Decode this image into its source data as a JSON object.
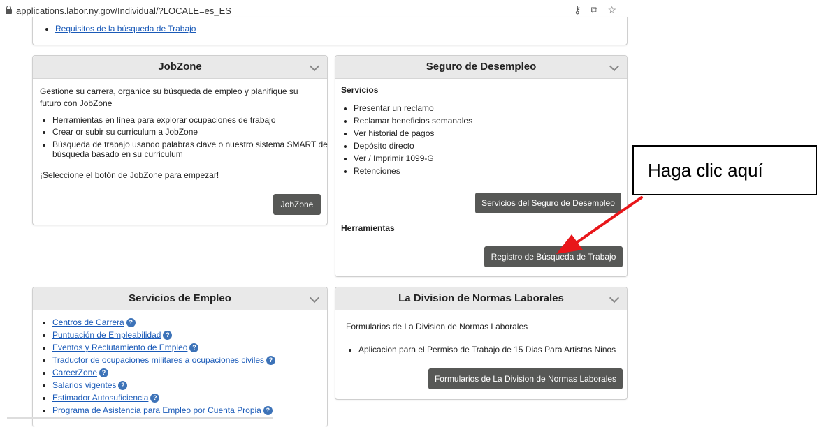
{
  "address_bar": {
    "url": "applications.labor.ny.gov/Individual/?LOCALE=es_ES",
    "icons": [
      "lock-icon",
      "key-icon",
      "translate-icon",
      "star-icon"
    ]
  },
  "top_card": {
    "link": "Requisitos de la búsqueda de Trabajo"
  },
  "jobzone": {
    "title": "JobZone",
    "intro": "Gestione su carrera, organice su búsqueda de empleo y planifique su futuro con JobZone",
    "items": [
      "Herramientas en línea para explorar ocupaciones de trabajo",
      "Crear or subir su curriculum a JobZone",
      "Búsqueda de trabajo usando palabras clave o nuestro sistema SMART de búsqueda basado en su curriculum"
    ],
    "cta_text": "¡Seleccione el botón de JobZone para empezar!",
    "button": "JobZone"
  },
  "seguro": {
    "title": "Seguro de Desempleo",
    "servicios_heading": "Servicios",
    "items": [
      "Presentar un reclamo",
      "Reclamar beneficios semanales",
      "Ver historial de pagos",
      "Depósito directo",
      "Ver / Imprimir 1099-G",
      "Retenciones"
    ],
    "servicios_button": "Servicios del Seguro de Desempleo",
    "herramientas_heading": "Herramientas",
    "herramientas_button": "Registro de Búsqueda de Trabajo"
  },
  "empleo": {
    "title": "Servicios de Empleo",
    "links": [
      "Centros de Carrera",
      "Puntuación de Empleabilidad",
      "Eventos y Reclutamiento de Empleo",
      "Traductor de ocupaciones militares a ocupaciones civiles",
      "CareerZone",
      "Salarios vigentes",
      "Estimador Autosuficiencia",
      "Programa de Asistencia para Empleo por Cuenta Propia"
    ],
    "help_glyph": "?"
  },
  "normas": {
    "title": "La Division de Normas Laborales",
    "intro": "Formularios de La Division de Normas Laborales",
    "items": [
      "Aplicacion para el Permiso de Trabajo de 15 Dias Para Artistas Ninos"
    ],
    "button": "Formularios de La Division de Normas Laborales"
  },
  "annotation": {
    "callout_text": "Haga clic aquí",
    "arrow_color": "#e8161a"
  }
}
